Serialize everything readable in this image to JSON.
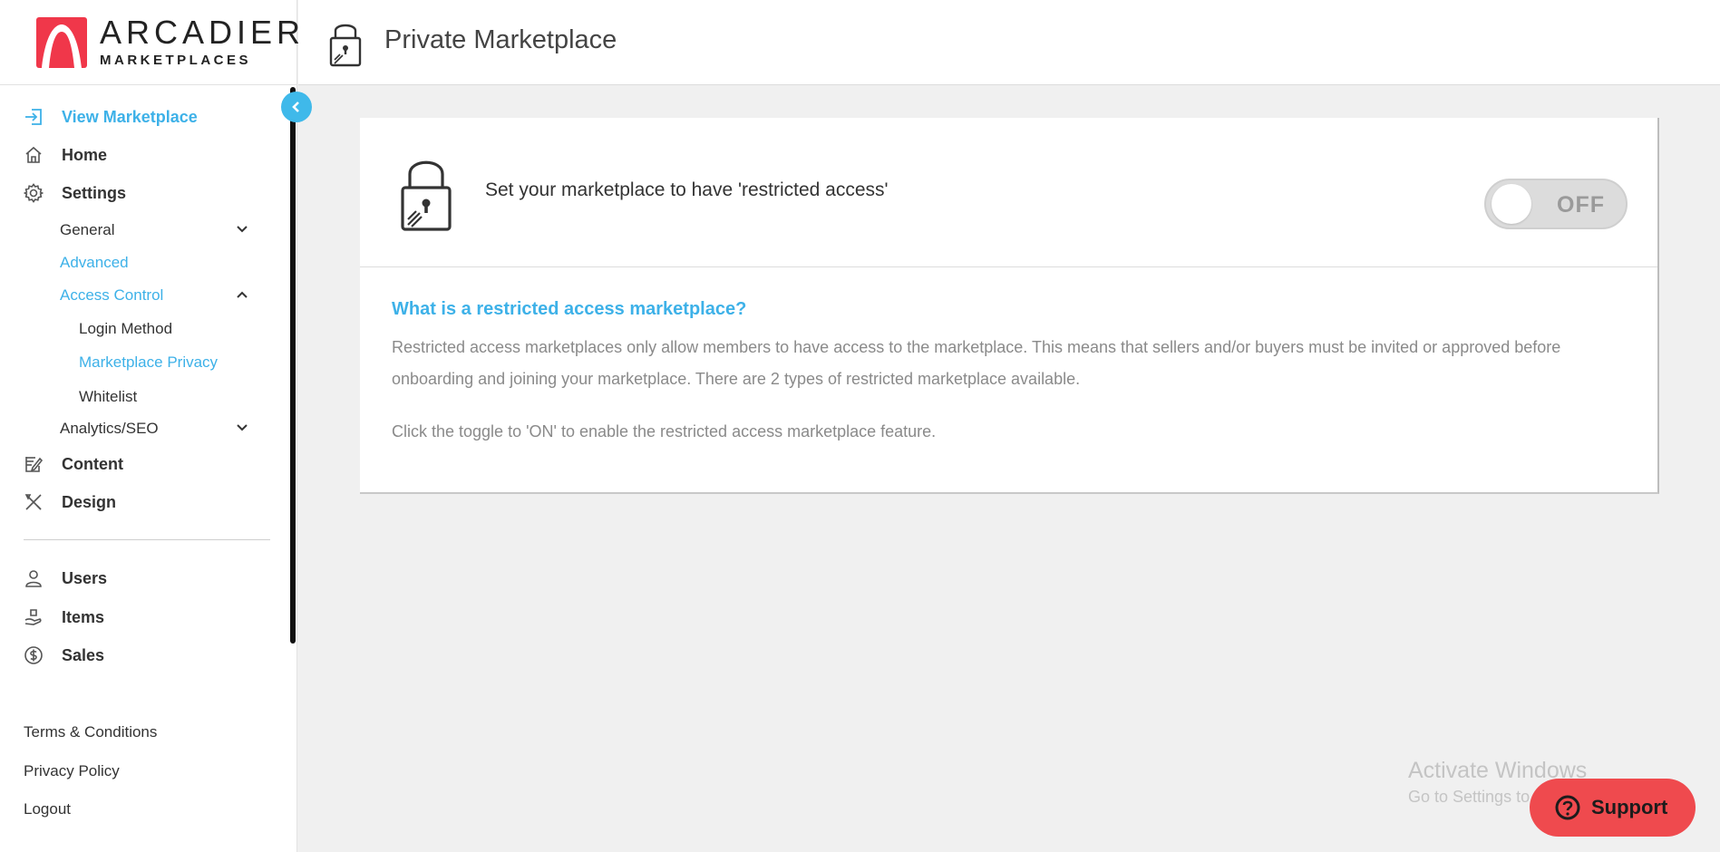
{
  "brand": {
    "name_line1": "ARCADIER",
    "name_line2": "MARKETPLACES",
    "accent": "#f0374a"
  },
  "colors": {
    "active": "#3db1e8",
    "support": "#ef4a4e"
  },
  "sidebar": {
    "primary": [
      {
        "label": "View Marketplace",
        "icon": "enter-icon",
        "active": true
      },
      {
        "label": "Home",
        "icon": "home-icon"
      },
      {
        "label": "Settings",
        "icon": "gear-icon"
      }
    ],
    "settings_sub": [
      {
        "label": "General",
        "expanded": false
      },
      {
        "label": "Advanced",
        "active": true
      },
      {
        "label": "Access Control",
        "expanded": true
      }
    ],
    "access_control_sub": [
      {
        "label": "Login Method"
      },
      {
        "label": "Marketplace Privacy",
        "active": true
      },
      {
        "label": "Whitelist"
      }
    ],
    "analytics": {
      "label": "Analytics/SEO",
      "expanded": false
    },
    "secondary": [
      {
        "label": "Content",
        "icon": "edit-icon"
      },
      {
        "label": "Design",
        "icon": "design-icon"
      }
    ],
    "management": [
      {
        "label": "Users",
        "icon": "user-icon"
      },
      {
        "label": "Items",
        "icon": "items-icon"
      },
      {
        "label": "Sales",
        "icon": "dollar-icon"
      }
    ],
    "footer": [
      {
        "label": "Terms & Conditions"
      },
      {
        "label": "Privacy Policy"
      },
      {
        "label": "Logout"
      }
    ]
  },
  "header": {
    "title": "Private Marketplace",
    "icon": "lock-icon"
  },
  "card": {
    "restrict_title": "Set your marketplace to have 'restricted access'",
    "toggle": {
      "state": "OFF",
      "on": false
    },
    "question": "What is a restricted access marketplace?",
    "description": "Restricted access marketplaces only allow members to have access to the marketplace. This means that sellers and/or buyers must be invited or approved before onboarding and joining your marketplace. There are 2 types of restricted marketplace available.",
    "hint": "Click the toggle to 'ON' to enable the restricted access marketplace feature."
  },
  "watermark": {
    "line1": "Activate Windows",
    "line2": "Go to Settings to activate Windows."
  },
  "support": {
    "label": "Support",
    "icon": "help-circle-icon"
  }
}
